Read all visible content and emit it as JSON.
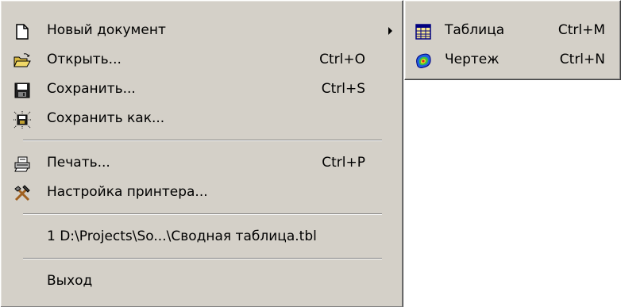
{
  "file_menu": {
    "items": [
      {
        "label": "Новый документ",
        "icon": "new-document-icon",
        "has_submenu": true
      },
      {
        "label": "Открыть...",
        "shortcut": "Ctrl+O",
        "icon": "open-folder-icon"
      },
      {
        "label": "Сохранить...",
        "shortcut": "Ctrl+S",
        "icon": "save-disk-icon"
      },
      {
        "label": "Сохранить как...",
        "icon": "save-as-icon"
      },
      {
        "label": "Печать...",
        "shortcut": "Ctrl+P",
        "icon": "printer-icon"
      },
      {
        "label": "Настройка принтера...",
        "icon": "printer-setup-icon"
      },
      {
        "label": "1 D:\\Projects\\So...\\Сводная таблица.tbl"
      },
      {
        "label": "Выход"
      }
    ]
  },
  "submenu": {
    "items": [
      {
        "label": "Таблица",
        "shortcut": "Ctrl+M",
        "icon": "table-icon"
      },
      {
        "label": "Чертеж",
        "shortcut": "Ctrl+N",
        "icon": "drawing-icon"
      }
    ]
  },
  "colors": {
    "menu_background": "#d4d0c8",
    "separator_dark": "#808080",
    "separator_light": "#ffffff"
  }
}
